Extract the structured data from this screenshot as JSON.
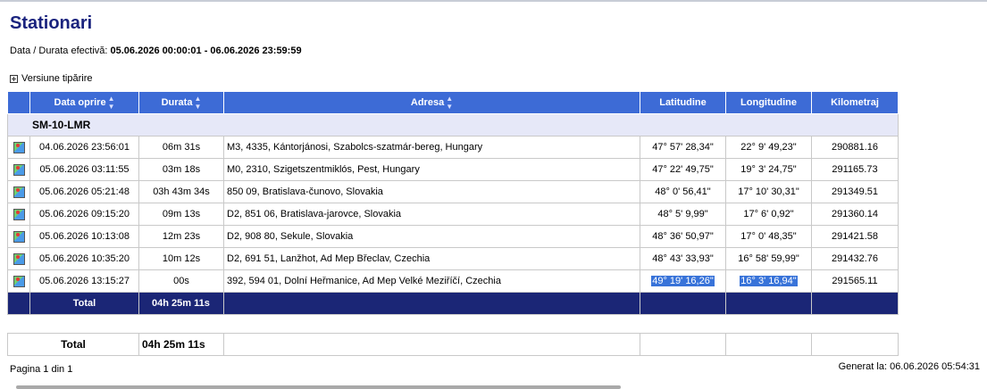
{
  "title": "Stationari",
  "duration": {
    "label": "Data / Durata efectivă:",
    "value": "05.06.2026 00:00:01 - 06.06.2026 23:59:59"
  },
  "print_version": "Versiune tipărire",
  "vehicle": "SM-10-LMR",
  "columns": {
    "date": "Data oprire",
    "duration": "Durata",
    "address": "Adresa",
    "latitude": "Latitudine",
    "longitude": "Longitudine",
    "km": "Kilometraj"
  },
  "rows": [
    {
      "date": "04.06.2026 23:56:01",
      "duration": "06m 31s",
      "address": "M3,  4335, Kántorjánosi, Szabolcs-szatmár-bereg, Hungary",
      "lat": "47° 57' 28,34\"",
      "lon": "22° 9' 49,23\"",
      "km": "290881.16"
    },
    {
      "date": "05.06.2026 03:11:55",
      "duration": "03m 18s",
      "address": "M0,  2310, Szigetszentmiklós, Pest, Hungary",
      "lat": "47° 22' 49,75\"",
      "lon": "19° 3' 24,75\"",
      "km": "291165.73"
    },
    {
      "date": "05.06.2026 05:21:48",
      "duration": "03h 43m 34s",
      "address": "850 09,  Bratislava-čunovo, Slovakia",
      "lat": "48° 0' 56,41\"",
      "lon": "17° 10' 30,31\"",
      "km": "291349.51"
    },
    {
      "date": "05.06.2026 09:15:20",
      "duration": "09m 13s",
      "address": "D2,  851 06,  Bratislava-jarovce, Slovakia",
      "lat": "48° 5' 9,99\"",
      "lon": "17° 6' 0,92\"",
      "km": "291360.14"
    },
    {
      "date": "05.06.2026 10:13:08",
      "duration": "12m 23s",
      "address": "D2,  908 80, Sekule,  Slovakia",
      "lat": "48° 36' 50,97\"",
      "lon": "17° 0' 48,35\"",
      "km": "291421.58"
    },
    {
      "date": "05.06.2026 10:35:20",
      "duration": "10m 12s",
      "address": "D2,  691 51, Lanžhot, Ad Mep Břeclav, Czechia",
      "lat": "48° 43' 33,93\"",
      "lon": "16° 58' 59,99\"",
      "km": "291432.76"
    },
    {
      "date": "05.06.2026 13:15:27",
      "duration": "00s",
      "address": "392,  594 01, Dolní Heřmanice, Ad Mep Velké Meziříčí, Czechia",
      "lat": "49° 19' 16,26\"",
      "lon": "16° 3' 16,94\"",
      "km": "291565.11"
    }
  ],
  "total": {
    "label": "Total",
    "value": "04h 25m 11s"
  },
  "grand_total": {
    "label": "Total",
    "value": "04h 25m 11s"
  },
  "footer": {
    "page": "Pagina 1 din 1",
    "generated": "Generat la: 06.06.2026 05:54:31"
  },
  "colors": {
    "title": "#1a237e",
    "header": "#3d6bd6",
    "vehicle_row": "#e6e8f8",
    "total_row": "#1b2676",
    "selection": "#3873d9"
  }
}
